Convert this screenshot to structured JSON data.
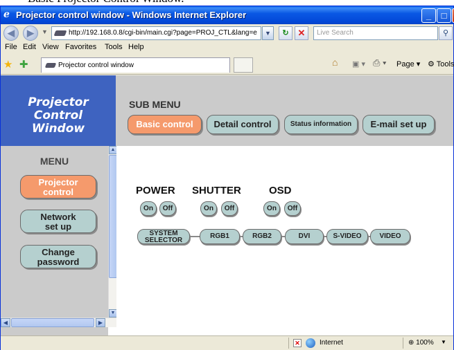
{
  "document_caption": "Basic Projector Control Window.",
  "window": {
    "title": "Projector control window - Windows Internet Explorer",
    "minimize_glyph": "_",
    "maximize_glyph": "□",
    "close_glyph": "X"
  },
  "address_bar": {
    "url": "http://192.168.0.8/cgi-bin/main.cgi?page=PROJ_CTL&lang=e",
    "search_placeholder": "Live Search"
  },
  "menu_bar": [
    "File",
    "Edit",
    "View",
    "Favorites",
    "Tools",
    "Help"
  ],
  "tab": {
    "label": "Projector control window"
  },
  "command_bar": {
    "page_label": "Page",
    "tools_label": "Tools"
  },
  "logo": {
    "line1": "Projector",
    "line2": "Control",
    "line3": "Window"
  },
  "submenu": {
    "title": "SUB MENU",
    "items": [
      {
        "label": "Basic control",
        "active": true
      },
      {
        "label": "Detail control",
        "active": false
      },
      {
        "label": "Status information",
        "active": false
      },
      {
        "label": "E-mail set up",
        "active": false
      }
    ]
  },
  "sidemenu": {
    "title": "MENU",
    "items": [
      {
        "label": "Projector\ncontrol",
        "active": true
      },
      {
        "label": "Network\nset up",
        "active": false
      },
      {
        "label": "Change\npassword",
        "active": false
      }
    ]
  },
  "controls": {
    "power": {
      "label": "POWER",
      "on": "On",
      "off": "Off"
    },
    "shutter": {
      "label": "SHUTTER",
      "on": "On",
      "off": "Off"
    },
    "osd": {
      "label": "OSD",
      "on": "On",
      "off": "Off"
    }
  },
  "inputs": {
    "system_selector": "SYSTEM\nSELECTOR",
    "rgb1": "RGB1",
    "rgb2": "RGB2",
    "dvi": "DVI",
    "svideo": "S-VIDEO",
    "video": "VIDEO"
  },
  "status_bar": {
    "zone": "Internet",
    "zoom": "100%"
  },
  "colors": {
    "active_button": "#f59a6c",
    "normal_button": "#b5d0cf",
    "logo_panel": "#3e63c0",
    "panel_gray": "#cbcbcb"
  }
}
